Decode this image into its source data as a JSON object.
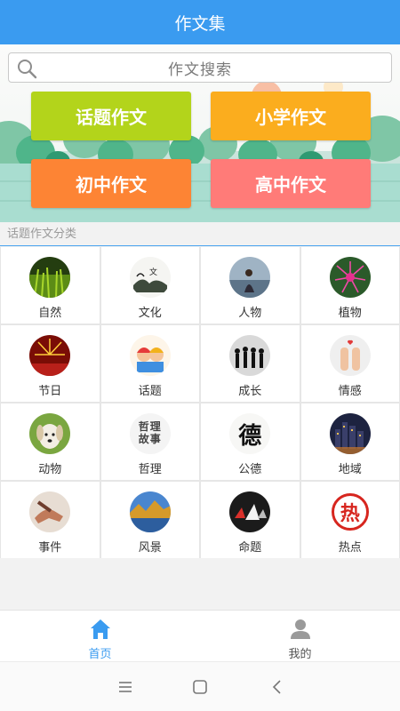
{
  "header": {
    "title": "作文集"
  },
  "search": {
    "placeholder": "作文搜索"
  },
  "categories": [
    {
      "label": "话题作文",
      "color": "#b3d41b"
    },
    {
      "label": "小学作文",
      "color": "#fbad1e"
    },
    {
      "label": "初中作文",
      "color": "#fd8434"
    },
    {
      "label": "高中作文",
      "color": "#ff7b78"
    }
  ],
  "section": {
    "title": "话题作文分类"
  },
  "topics": [
    {
      "label": "自然",
      "icon": "grass-photo"
    },
    {
      "label": "文化",
      "icon": "ink-landscape-photo"
    },
    {
      "label": "人物",
      "icon": "person-by-water-photo"
    },
    {
      "label": "植物",
      "icon": "pink-flower-photo"
    },
    {
      "label": "节日",
      "icon": "fireworks-photo"
    },
    {
      "label": "话题",
      "icon": "cartoon-kids-photo"
    },
    {
      "label": "成长",
      "icon": "silhouettes-photo"
    },
    {
      "label": "情感",
      "icon": "finger-couple-photo"
    },
    {
      "label": "动物",
      "icon": "puppy-photo"
    },
    {
      "label": "哲理",
      "icon": "philosophy-text-image",
      "caption": [
        "哲理",
        "故事"
      ]
    },
    {
      "label": "公德",
      "icon": "calligraphy-de-image",
      "glyph": "德"
    },
    {
      "label": "地域",
      "icon": "city-night-photo"
    },
    {
      "label": "事件",
      "icon": "hands-photo"
    },
    {
      "label": "风景",
      "icon": "lake-landscape-photo"
    },
    {
      "label": "命题",
      "icon": "paper-boats-photo"
    },
    {
      "label": "热点",
      "icon": "hot-stamp-image",
      "glyph": "热"
    }
  ],
  "tabs": [
    {
      "label": "首页",
      "icon": "home-icon",
      "active": true
    },
    {
      "label": "我的",
      "icon": "user-icon",
      "active": false
    }
  ],
  "colors": {
    "accent": "#3a9bf0",
    "inactive": "#555555"
  }
}
